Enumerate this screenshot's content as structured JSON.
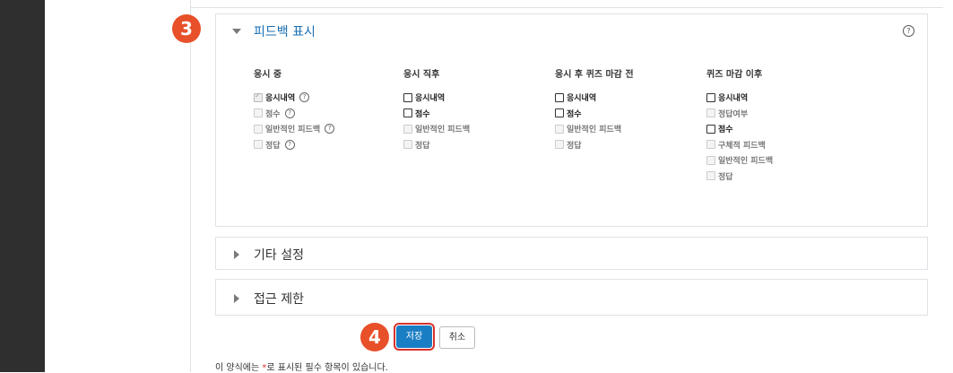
{
  "feedback_section": {
    "title": "피드백 표시",
    "help": "?",
    "columns": [
      {
        "header": "응시 중",
        "items": [
          {
            "label": "응시내역",
            "state": "checked-disabled",
            "help": true
          },
          {
            "label": "점수",
            "state": "disabled",
            "help": true
          },
          {
            "label": "일반적인 피드백",
            "state": "disabled",
            "help": true
          },
          {
            "label": "정답",
            "state": "disabled",
            "help": true
          }
        ]
      },
      {
        "header": "응시 직후",
        "items": [
          {
            "label": "응시내역",
            "state": "enabled"
          },
          {
            "label": "점수",
            "state": "enabled"
          },
          {
            "label": "일반적인 피드백",
            "state": "disabled"
          },
          {
            "label": "정답",
            "state": "disabled"
          }
        ]
      },
      {
        "header": "응시 후 퀴즈 마감 전",
        "items": [
          {
            "label": "응시내역",
            "state": "enabled"
          },
          {
            "label": "점수",
            "state": "enabled"
          },
          {
            "label": "일반적인 피드백",
            "state": "disabled"
          },
          {
            "label": "정답",
            "state": "disabled"
          }
        ]
      },
      {
        "header": "퀴즈 마감 이후",
        "items": [
          {
            "label": "응시내역",
            "state": "enabled"
          },
          {
            "label": "정답여부",
            "state": "disabled"
          },
          {
            "label": "점수",
            "state": "enabled"
          },
          {
            "label": "구체적 피드백",
            "state": "disabled"
          },
          {
            "label": "일반적인 피드백",
            "state": "disabled"
          },
          {
            "label": "정답",
            "state": "disabled"
          }
        ]
      }
    ]
  },
  "other_settings": {
    "title": "기타 설정"
  },
  "access_restriction": {
    "title": "접근 제한"
  },
  "buttons": {
    "save": "저장",
    "cancel": "취소"
  },
  "badges": {
    "step3": "3",
    "step4": "4"
  },
  "required_note": {
    "prefix": "이 양식에는 ",
    "mark": "*",
    "suffix": "로 표시된 필수 항목이 있습니다."
  },
  "colors": {
    "accent": "#1a7ec4",
    "badge": "#e8502a",
    "highlight_border": "#d9322b"
  }
}
